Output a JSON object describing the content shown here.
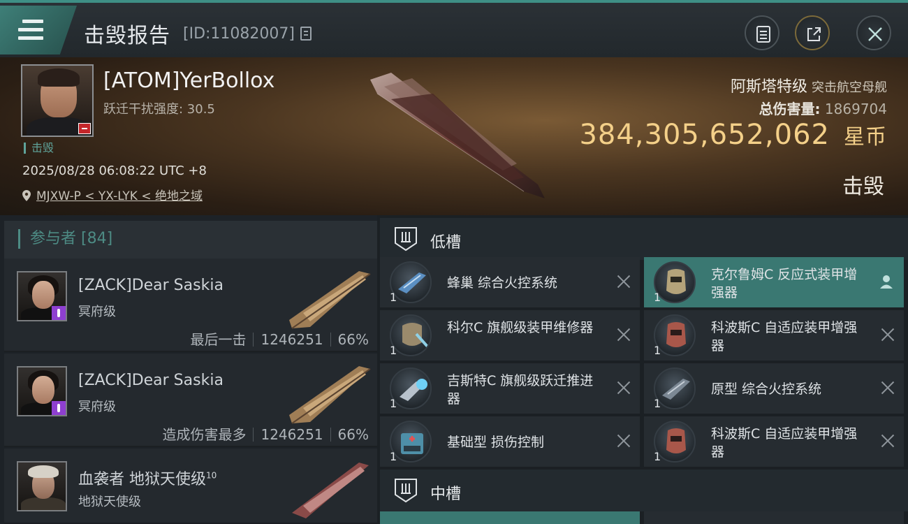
{
  "titlebar": {
    "title": "击毁报告",
    "id_text": "[ID:11082007]"
  },
  "hero": {
    "pilot_name": "[ATOM]YerBollox",
    "warp_text": "跃迁干扰强度: 30.5",
    "tag": "击毁",
    "time": "2025/08/28 06:08:22 UTC +8",
    "location": "MJXW-P < YX-LYK < 绝地之域",
    "ship_name": "阿斯塔特级",
    "ship_class": "突击航空母舰",
    "damage_label": "总伤害量:",
    "damage_value": "1869704",
    "isk_value": "384,305,652,062",
    "isk_unit": "星币",
    "status": "击毁"
  },
  "participants": {
    "header": "参与者 [84]",
    "rows": [
      {
        "name": "[ZACK]Dear Saskia",
        "ship": "冥府级",
        "stat_label": "最后一击",
        "damage": "1246251",
        "percent": "66%"
      },
      {
        "name": "[ZACK]Dear Saskia",
        "ship": "冥府级",
        "stat_label": "造成伤害最多",
        "damage": "1246251",
        "percent": "66%"
      },
      {
        "name": "血袭者 地狱天使级",
        "name_sup": "10",
        "ship": "地狱天使级"
      }
    ]
  },
  "fittings": {
    "low_label": "低槽",
    "mid_label": "中槽",
    "low_modules": [
      {
        "name": "蜂巢 综合火控系统",
        "count": "1"
      },
      {
        "name": "克尔鲁姆C 反应式装甲增强器",
        "count": "1"
      },
      {
        "name": "科尔C 旗舰级装甲维修器",
        "count": "1"
      },
      {
        "name": "科波斯C 自适应装甲增强器",
        "count": "1"
      },
      {
        "name": "吉斯特C 旗舰级跃迁推进器",
        "count": "1"
      },
      {
        "name": "原型 综合火控系统",
        "count": "1"
      },
      {
        "name": "基础型 损伤控制",
        "count": "1"
      },
      {
        "name": "科波斯C 自适应装甲增强器",
        "count": "1"
      }
    ]
  },
  "colors": {
    "accent": "#3e8f86",
    "isk_gold": "#f4d089",
    "selected": "#3a7872"
  }
}
